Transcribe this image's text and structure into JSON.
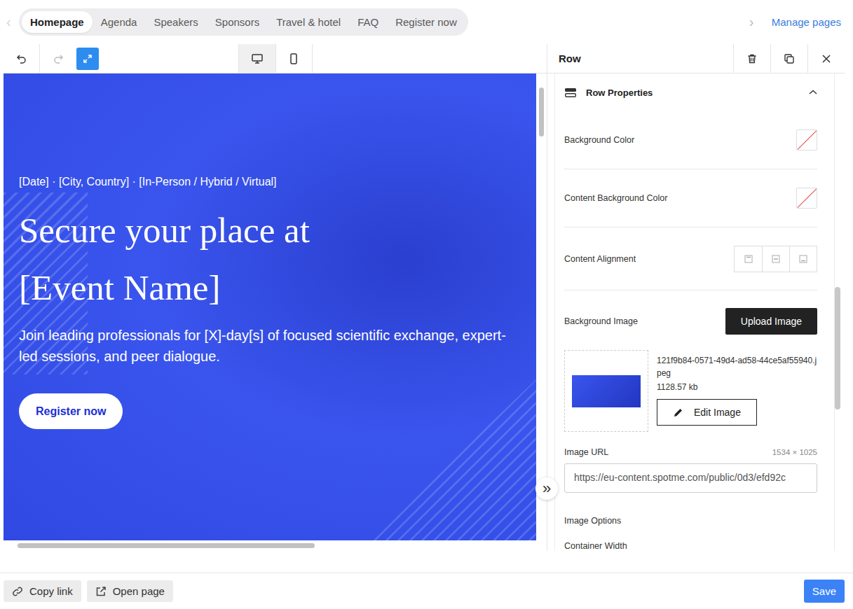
{
  "page_tabs": {
    "prev": "‹",
    "next": "›",
    "items": [
      {
        "label": "Homepage",
        "selected": true
      },
      {
        "label": "Agenda",
        "selected": false
      },
      {
        "label": "Speakers",
        "selected": false
      },
      {
        "label": "Sponsors",
        "selected": false
      },
      {
        "label": "Travel & hotel",
        "selected": false
      },
      {
        "label": "FAQ",
        "selected": false
      },
      {
        "label": "Register now",
        "selected": false
      }
    ],
    "manage": "Manage pages"
  },
  "toolbar": {
    "redo_disabled": true,
    "fullscreen_active": true,
    "devices": [
      {
        "name": "desktop",
        "selected": true
      },
      {
        "name": "mobile",
        "selected": false
      }
    ]
  },
  "hero": {
    "meta": "[Date] · [City, Country] · [In-Person / Hybrid / Virtual]",
    "heading_lines": [
      "Secure your place at",
      "[Event Name]"
    ],
    "text": "Join leading professionals for [X]-day[s] of focused scientific exchange, expert-led sessions, and peer dialogue.",
    "button": "Register now"
  },
  "collapse": "»",
  "panel": {
    "title": "Row",
    "section": {
      "title": "Row Properties",
      "expanded": true
    },
    "fields": [
      {
        "kind": "color",
        "label": "Background Color",
        "empty": true
      },
      {
        "kind": "color",
        "label": "Content Background Color",
        "empty": true
      },
      {
        "kind": "alignment",
        "label": "Content Alignment",
        "options": [
          {
            "name": "top",
            "selected": false
          },
          {
            "name": "middle",
            "selected": false
          },
          {
            "name": "bottom",
            "selected": false
          }
        ]
      },
      {
        "kind": "image",
        "label": "Background Image",
        "button": "Upload Image",
        "file": "121f9b84-0571-49d4-ad58-44ce5af55940.jpeg",
        "size": "1128.57 kb",
        "edit": "Edit Image"
      },
      {
        "kind": "url",
        "label": "Image URL",
        "dimensions": "1534 × 1025",
        "value": "https://eu-content.spotme.com/public/0d3/efd92c"
      },
      {
        "kind": "heading",
        "label": "Image Options"
      },
      {
        "kind": "heading",
        "label": "Container Width"
      }
    ]
  },
  "footer": {
    "buttons": [
      "Copy link",
      "Open page"
    ],
    "save": "Save"
  }
}
